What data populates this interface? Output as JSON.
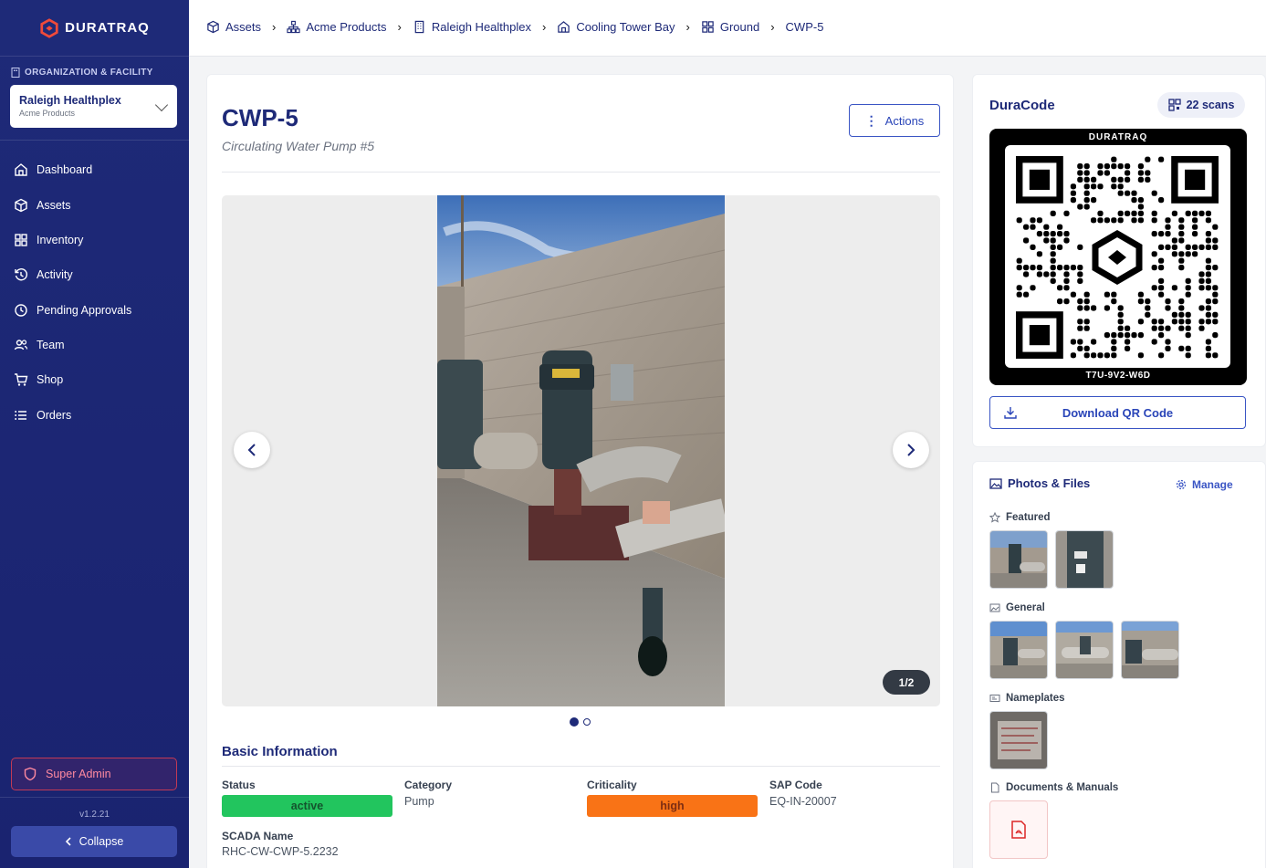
{
  "app": {
    "brand": "DURATRAQ",
    "version": "v1.2.21"
  },
  "sidebar": {
    "org_label": "ORGANIZATION & FACILITY",
    "facility": "Raleigh Healthplex",
    "organization": "Acme Products",
    "items": [
      {
        "label": "Dashboard",
        "icon": "home-icon"
      },
      {
        "label": "Assets",
        "icon": "cube-icon"
      },
      {
        "label": "Inventory",
        "icon": "grid-icon"
      },
      {
        "label": "Activity",
        "icon": "history-icon"
      },
      {
        "label": "Pending Approvals",
        "icon": "clock-icon"
      },
      {
        "label": "Team",
        "icon": "team-icon"
      },
      {
        "label": "Shop",
        "icon": "cart-icon"
      },
      {
        "label": "Orders",
        "icon": "list-icon"
      }
    ],
    "admin_label": "Super Admin",
    "collapse_label": "Collapse"
  },
  "breadcrumb": [
    "Assets",
    "Acme Products",
    "Raleigh Healthplex",
    "Cooling Tower Bay",
    "Ground",
    "CWP-5"
  ],
  "asset": {
    "title": "CWP-5",
    "subtitle": "Circulating Water Pump #5",
    "actions_label": "Actions",
    "gallery_counter": "1/2",
    "gallery_index": 1,
    "gallery_total": 2
  },
  "basic_info": {
    "heading": "Basic Information",
    "status_label": "Status",
    "status_value": "active",
    "category_label": "Category",
    "category_value": "Pump",
    "criticality_label": "Criticality",
    "criticality_value": "high",
    "sap_label": "SAP Code",
    "sap_value": "EQ-IN-20007",
    "scada_label": "SCADA Name",
    "scada_value": "RHC-CW-CWP-5.2232"
  },
  "duracode": {
    "title": "DuraCode",
    "scans": "22 scans",
    "qr_header": "DURATRAQ",
    "qr_code": "T7U-9V2-W6D",
    "download_label": "Download QR Code"
  },
  "photos": {
    "title": "Photos & Files",
    "manage_label": "Manage",
    "groups": [
      "Featured",
      "General",
      "Nameplates",
      "Documents & Manuals"
    ]
  },
  "colors": {
    "sidebar": "#1e2a78",
    "accent": "#2a45b8",
    "active": "#22c55e",
    "high": "#f97316"
  }
}
